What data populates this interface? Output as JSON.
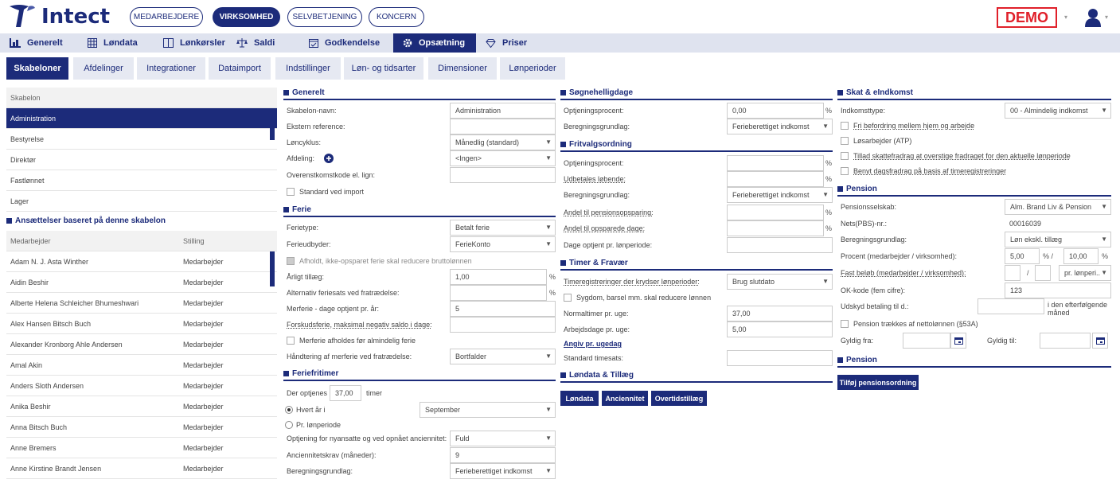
{
  "app": {
    "name": "Intect"
  },
  "top_pills": [
    {
      "label": "MEDARBEJDERE"
    },
    {
      "label": "VIRKSOMHED"
    },
    {
      "label": "SELVBETJENING"
    },
    {
      "label": "KONCERN"
    }
  ],
  "demo_label": "DEMO",
  "nav": [
    {
      "label": "Generelt",
      "icon": "bar-chart-icon"
    },
    {
      "label": "Løndata",
      "icon": "grid-icon"
    },
    {
      "label": "Lønkørsler",
      "icon": "book-icon"
    },
    {
      "label": "Saldi",
      "icon": "scale-icon"
    },
    {
      "label": "Godkendelse",
      "icon": "calendar-check-icon"
    },
    {
      "label": "Opsætning",
      "icon": "gear-icon"
    },
    {
      "label": "Priser",
      "icon": "diamond-icon"
    }
  ],
  "tabs": [
    "Skabeloner",
    "Afdelinger",
    "Integrationer",
    "Dataimport",
    "Indstillinger",
    "Løn- og tidsarter",
    "Dimensioner",
    "Lønperioder"
  ],
  "templates": {
    "header": "Skabelon",
    "items": [
      "Administration",
      "Bestyrelse",
      "Direktør",
      "Fastlønnet",
      "Lager"
    ]
  },
  "employments": {
    "title": "Ansættelser baseret på denne skabelon",
    "col1": "Medarbejder",
    "col2": "Stilling",
    "rows": [
      [
        "Adam N. J. Asta Winther",
        "Medarbejder"
      ],
      [
        "Aidin Beshir",
        "Medarbejder"
      ],
      [
        "Alberte Helena Schleicher Bhumeshwari",
        "Medarbejder"
      ],
      [
        "Alex Hansen Bitsch Buch",
        "Medarbejder"
      ],
      [
        "Alexander Kronborg Ahle Andersen",
        "Medarbejder"
      ],
      [
        "Amal Akin",
        "Medarbejder"
      ],
      [
        "Anders Sloth Andersen",
        "Medarbejder"
      ],
      [
        "Anika Beshir",
        "Medarbejder"
      ],
      [
        "Anna Bitsch Buch",
        "Medarbejder"
      ],
      [
        "Anne Bremers",
        "Medarbejder"
      ],
      [
        "Anne Kirstine Brandt Jensen",
        "Medarbejder"
      ]
    ]
  },
  "generelt": {
    "title": "Generelt",
    "skabelon_navn_label": "Skabelon-navn:",
    "skabelon_navn_value": "Administration",
    "ekstern_label": "Ekstern reference:",
    "loncyklus_label": "Løncyklus:",
    "loncyklus_value": "Månedlig (standard)",
    "afdeling_label": "Afdeling:",
    "afdeling_value": "<Ingen>",
    "overens_label": "Overenstkomstkode el. lign:",
    "standard_import_label": "Standard ved import"
  },
  "ferie": {
    "title": "Ferie",
    "ferietype_label": "Ferietype:",
    "ferietype_value": "Betalt ferie",
    "ferieudbyder_label": "Ferieudbyder:",
    "ferieudbyder_value": "FerieKonto",
    "afholdt_label": "Afholdt, ikke-opsparet ferie skal reducere bruttolønnen",
    "aarligt_label": "Årligt tillæg:",
    "aarligt_value": "1,00",
    "alt_ferie_label": "Alternativ feriesats ved fratrædelse:",
    "merferie_label": "Merferie - dage optjent pr. år:",
    "merferie_value": "5",
    "forskud_label": "Forskudsferie, maksimal negativ saldo i dage:",
    "merferie_afholdes_label": "Merferie afholdes før almindelig ferie",
    "handtering_label": "Håndtering af merferie ved fratrædelse:",
    "handtering_value": "Bortfalder",
    "pct": "%"
  },
  "feriefritimer": {
    "title": "Feriefritimer",
    "der_optjenes": "Der optjenes",
    "hours_value": "37,00",
    "timer": "timer",
    "hvert_aar": "Hvert år i",
    "month_value": "September",
    "pr_lonperiode": "Pr. lønperiode",
    "optjening_label": "Optjening for nyansatte og ved opnået anciennitet:",
    "optjening_value": "Fuld",
    "anciennitet_label": "Anciennitetskrav (måneder):",
    "anciennitet_value": "9",
    "beregning_label": "Beregningsgrundlag:",
    "beregning_value": "Ferieberettiget indkomst"
  },
  "sogne": {
    "title": "Søgnehelligdage",
    "optjening_label": "Optjeningsprocent:",
    "optjening_value": "0,00",
    "beregning_label": "Beregningsgrundlag:",
    "beregning_value": "Ferieberettiget indkomst"
  },
  "fritvalg": {
    "title": "Fritvalgsordning",
    "optjening_label": "Optjeningsprocent:",
    "udbetales_label": "Udbetales løbende:",
    "beregning_label": "Beregningsgrundlag:",
    "beregning_value": "Ferieberettiget indkomst",
    "andel_pension_label": "Andel til pensionsopsparing:",
    "andel_dage_label": "Andel til opsparede dage:",
    "dage_optjent_label": "Dage optjent pr. lønperiode:"
  },
  "timer": {
    "title": "Timer & Fravær",
    "timereg_label": "Timeregistreringer der krydser lønperioder:",
    "timereg_value": "Brug slutdato",
    "sygdom_label": "Sygdom, barsel mm. skal reducere lønnen",
    "normaltimer_label": "Normaltimer pr. uge:",
    "normaltimer_value": "37,00",
    "arbejdsdage_label": "Arbejdsdage pr. uge:",
    "arbejdsdage_value": "5,00",
    "angiv_label": "Angiv pr. ugedag",
    "standard_timesats_label": "Standard timesats:"
  },
  "londata": {
    "title": "Løndata & Tillæg",
    "buttons": [
      "Løndata",
      "Anciennitet",
      "Overtidstillæg"
    ]
  },
  "skat": {
    "title": "Skat & eIndkomst",
    "indkomsttype_label": "Indkomsttype:",
    "indkomsttype_value": "00 - Almindelig indkomst",
    "cb1": "Fri befordring mellem hjem og arbejde",
    "cb2": "Løsarbejder (ATP)",
    "cb3": "Tillad skattefradrag at overstige fradraget for den aktuelle lønperiode",
    "cb4": "Benyt dagsfradrag på basis af timeregistreringer"
  },
  "pension": {
    "title": "Pension",
    "selskab_label": "Pensionsselskab:",
    "selskab_value": "Alm. Brand Liv & Pension",
    "nets_label": "Nets(PBS)-nr.:",
    "nets_value": "00016039",
    "beregning_label": "Beregningsgrundlag:",
    "beregning_value": "Løn ekskl. tillæg",
    "procent_label": "Procent (medarbejder / virksomhed):",
    "procent_emp": "5,00",
    "procent_comp": "10,00",
    "pct_slash": "% /",
    "pct": "%",
    "fast_label": "Fast beløb (medarbejder / virksomhed):",
    "slash": "/",
    "per_value": "pr. lønperi..",
    "ok_label": "OK-kode (fem cifre):",
    "ok_value": "123",
    "udskyd_label": "Udskyd betaling til d.:",
    "udskyd_suffix": "i den efterfølgende måned",
    "netto_label": "Pension trækkes af nettolønnen (§53A)",
    "gyldig_fra": "Gyldig fra:",
    "gyldig_til": "Gyldig til:",
    "title2": "Pension",
    "add_button": "Tilføj pensionsordning"
  }
}
